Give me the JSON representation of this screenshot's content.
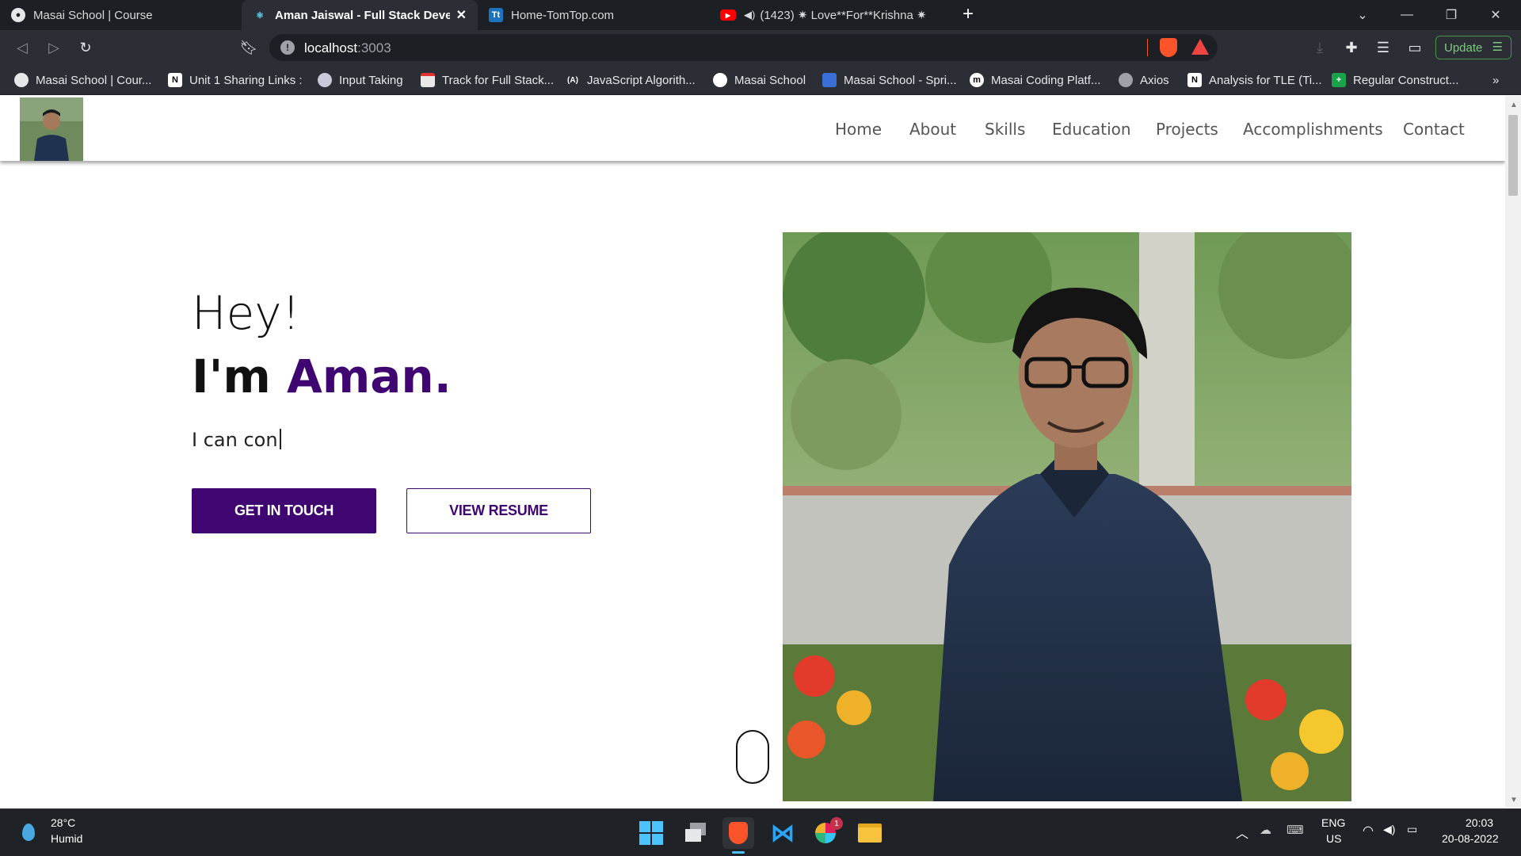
{
  "browser": {
    "tabs": [
      {
        "title": "Masai School | Course",
        "icon": "globe-icon",
        "active": false
      },
      {
        "title": "Aman Jaiswal - Full Stack Develop",
        "icon": "react-icon",
        "active": true
      },
      {
        "title": "Home-TomTop.com",
        "icon": "tomtop-icon",
        "active": false
      },
      {
        "title": "(1423) ✷ Love**For**Krishna ✷",
        "icon": "youtube-icon",
        "active": false
      }
    ],
    "url_host": "localhost",
    "url_port": ":3003",
    "update_label": "Update",
    "bookmarks": [
      {
        "label": "Masai School | Cour...",
        "icon": "globe-icon"
      },
      {
        "label": "Unit 1 Sharing Links :",
        "icon": "notion-icon"
      },
      {
        "label": "Input Taking",
        "icon": "input-icon"
      },
      {
        "label": "Track for Full Stack...",
        "icon": "calendar-icon"
      },
      {
        "label": "JavaScript Algorith...",
        "icon": "algo-icon"
      },
      {
        "label": "Masai School",
        "icon": "github-icon"
      },
      {
        "label": "Masai School - Spri...",
        "icon": "sprint-icon"
      },
      {
        "label": "Masai Coding Platf...",
        "icon": "masai-icon"
      },
      {
        "label": "Axios",
        "icon": "globe-icon"
      },
      {
        "label": "Analysis for TLE (Ti...",
        "icon": "notion-icon"
      },
      {
        "label": "Regular Construct...",
        "icon": "plus-icon"
      }
    ],
    "bookmarks_overflow": "»"
  },
  "site": {
    "nav": [
      "Home",
      "About",
      "Skills",
      "Education",
      "Projects",
      "Accomplishments",
      "Contact"
    ],
    "hero": {
      "greeting": "Hey!",
      "intro_prefix": "I'm ",
      "intro_name": "Aman.",
      "typing_text": "I can con",
      "primary_button": "GET IN TOUCH",
      "secondary_button": "VIEW RESUME"
    },
    "accent_color": "#3f0671"
  },
  "taskbar": {
    "weather_temp": "28°C",
    "weather_desc": "Humid",
    "lang_line1": "ENG",
    "lang_line2": "US",
    "time": "20:03",
    "date": "20-08-2022",
    "slack_badge": "1"
  }
}
